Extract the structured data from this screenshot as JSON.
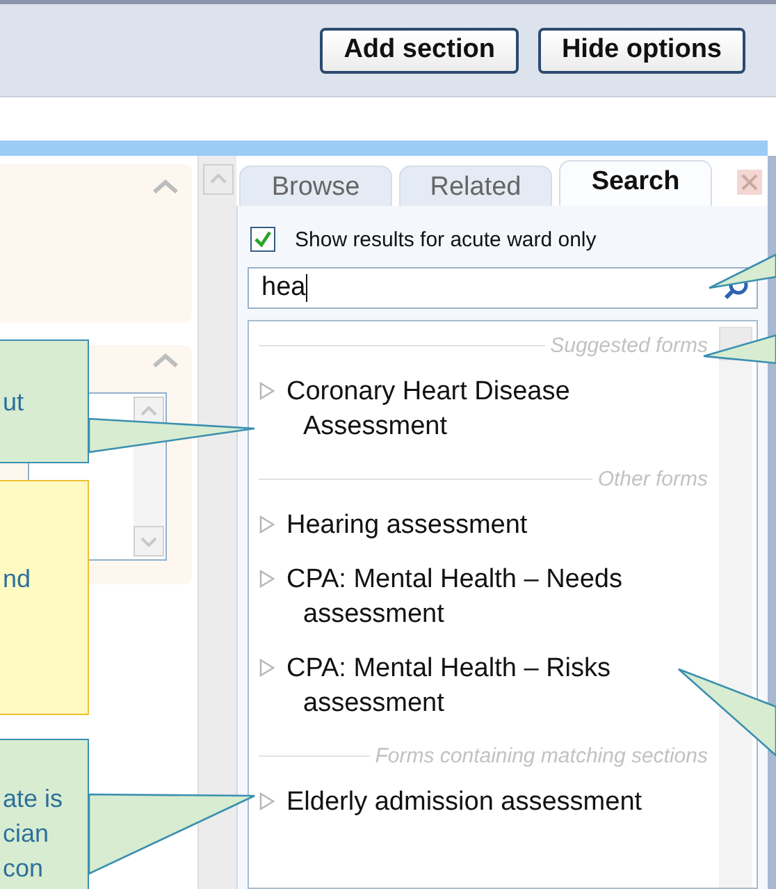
{
  "toolbar": {
    "buttons": [
      "Add section",
      "Hide options"
    ]
  },
  "side_panel": {
    "tabs": [
      {
        "label": "Browse",
        "selected": false
      },
      {
        "label": "Related",
        "selected": false
      },
      {
        "label": "Search",
        "selected": true
      }
    ],
    "filter": {
      "label": "Show results for acute ward only",
      "checked": true
    },
    "search": {
      "value": "hea"
    },
    "groups": [
      {
        "heading": "Suggested forms",
        "items": [
          "Coronary Heart Disease Assessment"
        ]
      },
      {
        "heading": "Other forms",
        "items": [
          "Hearing assessment",
          "CPA: Mental Health – Needs assessment",
          "CPA: Mental Health – Risks assessment"
        ]
      },
      {
        "heading": "Forms containing matching sections",
        "items": [
          "Elderly admission assessment"
        ]
      }
    ]
  },
  "callouts": [
    {
      "kind": "tip",
      "text": "ut"
    },
    {
      "kind": "note",
      "text": "nd"
    },
    {
      "kind": "tip",
      "text": "ate is\ncian\ncon"
    }
  ]
}
